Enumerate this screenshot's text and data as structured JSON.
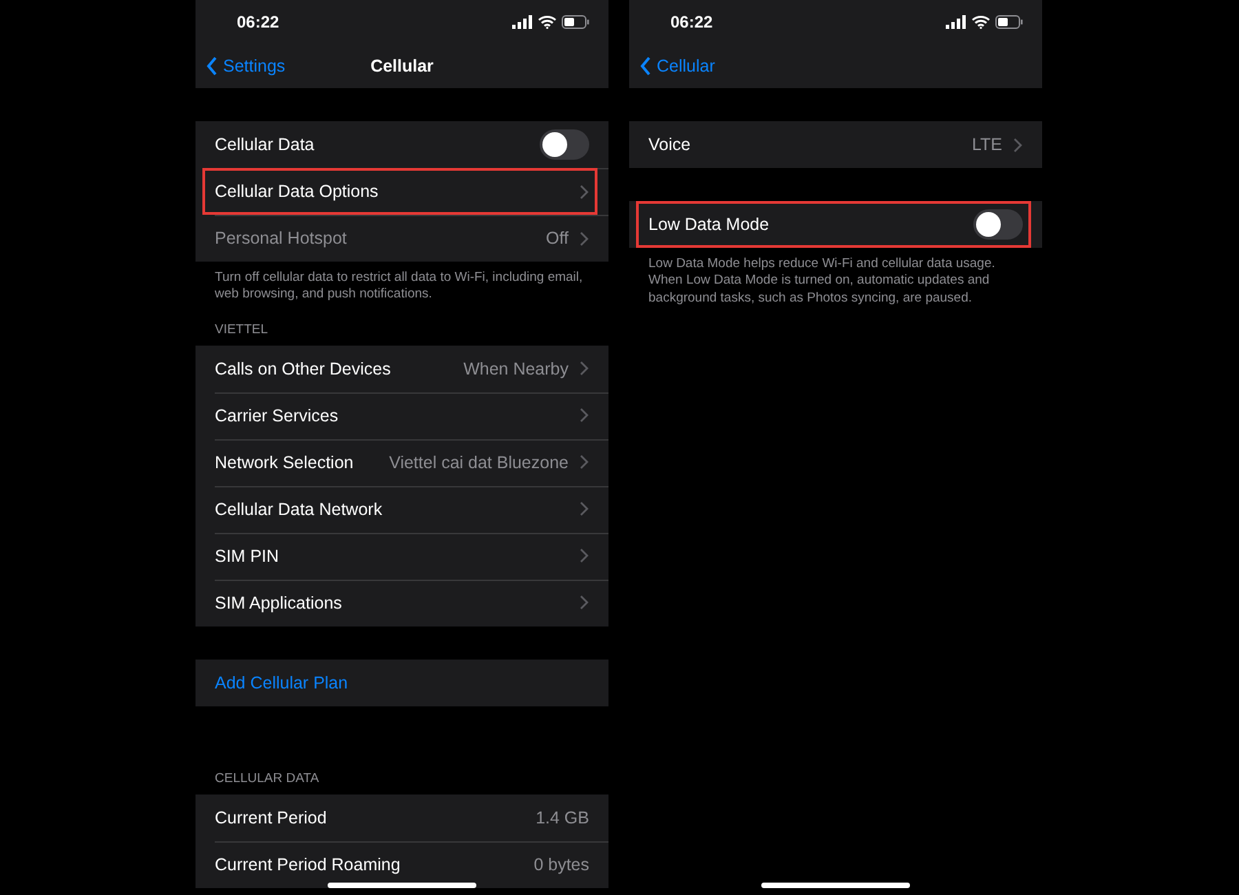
{
  "screens": [
    {
      "status_bar": {
        "time": "06:22"
      },
      "nav": {
        "back": "Settings",
        "title": "Cellular"
      },
      "sections": [
        {
          "rows": [
            {
              "kind": "toggle",
              "label": "Cellular Data",
              "on": false,
              "highlighted": false,
              "disabled": false
            },
            {
              "kind": "link",
              "label": "Cellular Data Options",
              "highlighted": true,
              "disabled": false
            },
            {
              "kind": "link",
              "label": "Personal Hotspot",
              "value": "Off",
              "highlighted": false,
              "disabled": true
            }
          ],
          "footer": "Turn off cellular data to restrict all data to Wi-Fi, including email, web browsing, and push notifications."
        },
        {
          "header": "VIETTEL",
          "rows": [
            {
              "kind": "link",
              "label": "Calls on Other Devices",
              "value": "When Nearby",
              "highlighted": false,
              "disabled": false
            },
            {
              "kind": "link",
              "label": "Carrier Services",
              "highlighted": false,
              "disabled": false
            },
            {
              "kind": "link",
              "label": "Network Selection",
              "value": "Viettel cai dat Bluezone",
              "highlighted": false,
              "disabled": false
            },
            {
              "kind": "link",
              "label": "Cellular Data Network",
              "highlighted": false,
              "disabled": false
            },
            {
              "kind": "link",
              "label": "SIM PIN",
              "highlighted": false,
              "disabled": false
            },
            {
              "kind": "link",
              "label": "SIM Applications",
              "highlighted": false,
              "disabled": false
            }
          ]
        },
        {
          "rows": [
            {
              "kind": "action",
              "label": "Add Cellular Plan",
              "highlighted": false,
              "disabled": false
            }
          ]
        },
        {
          "header": "CELLULAR DATA",
          "rows": [
            {
              "kind": "info",
              "label": "Current Period",
              "value": "1.4 GB",
              "highlighted": false,
              "disabled": false
            },
            {
              "kind": "info",
              "label": "Current Period Roaming",
              "value": "0 bytes",
              "highlighted": false,
              "disabled": false
            }
          ]
        }
      ]
    },
    {
      "status_bar": {
        "time": "06:22"
      },
      "nav": {
        "back": "Cellular"
      },
      "sections": [
        {
          "rows": [
            {
              "kind": "link",
              "label": "Voice",
              "value": "LTE",
              "highlighted": false,
              "disabled": false
            }
          ]
        },
        {
          "rows": [
            {
              "kind": "toggle",
              "label": "Low Data Mode",
              "on": false,
              "highlighted": true,
              "disabled": false
            }
          ],
          "footer": "Low Data Mode helps reduce Wi-Fi and cellular data usage. When Low Data Mode is turned on, automatic updates and background tasks, such as Photos syncing, are paused."
        }
      ]
    }
  ]
}
